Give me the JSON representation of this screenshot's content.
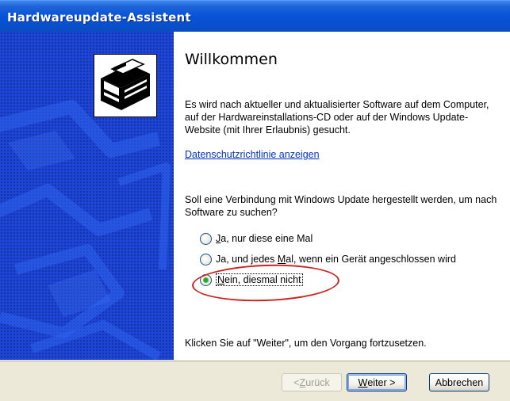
{
  "window": {
    "title": "Hardwareupdate-Assistent"
  },
  "content": {
    "heading": "Willkommen",
    "intro": "Es wird nach aktueller und aktualisierter Software auf dem Computer, auf der Hardwareinstallations-CD oder auf der Windows Update-Website (mit Ihrer Erlaubnis) gesucht.",
    "privacy_link": "Datenschutzrichtlinie anzeigen",
    "question": "Soll eine Verbindung mit Windows Update hergestellt werden, um nach Software zu suchen?",
    "options": [
      {
        "pre": "",
        "key": "J",
        "post": "a, nur diese eine Mal",
        "selected": false
      },
      {
        "pre": "Ja, und jedes ",
        "key": "M",
        "post": "al, wenn ein Gerät angeschlossen wird",
        "selected": false
      },
      {
        "pre": "",
        "key": "N",
        "post": "ein, diesmal nicht",
        "selected": true
      }
    ],
    "closing": "Klicken Sie auf \"Weiter\", um den Vorgang fortzusetzen."
  },
  "buttons": {
    "back": {
      "pre": "< ",
      "key": "Z",
      "post": "urück",
      "enabled": false
    },
    "next": {
      "pre": "",
      "key": "W",
      "post": "eiter >",
      "enabled": true
    },
    "cancel": {
      "label": "Abbrechen",
      "enabled": true
    }
  },
  "colors": {
    "titlebar": "#0a55d8",
    "side_panel": "#1d45d6",
    "highlight": "#cc2222",
    "link": "#0033cc",
    "button_bar": "#ece9d8"
  },
  "icons": {
    "wizard": "hardware-install-icon"
  }
}
